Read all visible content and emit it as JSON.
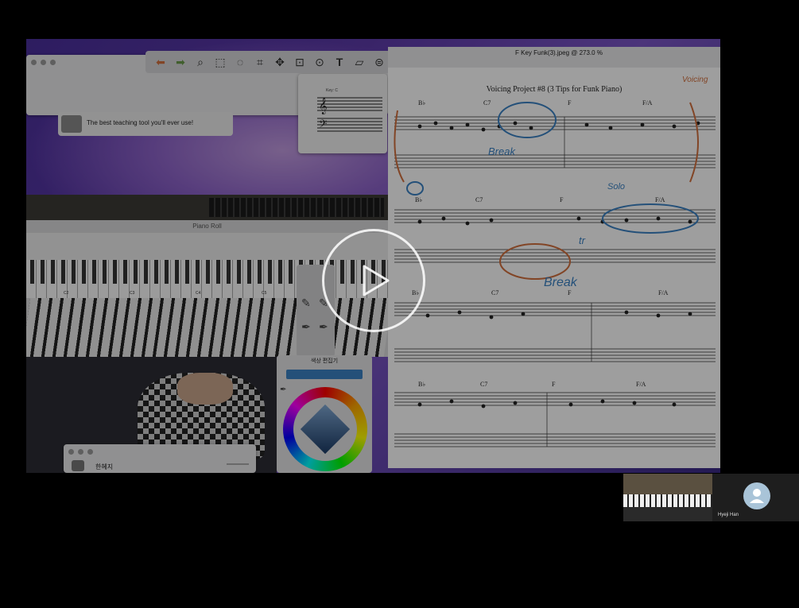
{
  "score": {
    "window_title": "F Key Funk(3).jpeg @ 273.0 %",
    "title": "Voicing Project #8 (3 Tips for Funk Piano)",
    "chords_row1": [
      "B♭",
      "C7",
      "F",
      "F/A"
    ],
    "chords_row2": [
      "B♭",
      "C7",
      "F",
      "F/A"
    ],
    "chords_row3": [
      "B♭",
      "C7",
      "F",
      "F/A"
    ],
    "chords_row4": [
      "B♭",
      "C7",
      "F",
      "F/A"
    ],
    "annotations": [
      "Break",
      "Solo",
      "tr",
      "Break",
      "Voicing"
    ]
  },
  "teacher_window": {
    "caption": "The best teaching tool you'll ever use!"
  },
  "key_window": {
    "label": "Key: C"
  },
  "piano_roll": {
    "title": "Piano Roll",
    "octave_labels": [
      "C2",
      "C3",
      "C4",
      "C5"
    ]
  },
  "color_editor": {
    "title": "색상 편집기"
  },
  "bottom_window": {
    "user": "한혜지"
  },
  "participant": {
    "name": "Hyeji Han"
  },
  "colors": {
    "annotation_blue": "#3b82c4",
    "annotation_orange": "#d2703e",
    "desktop_purple": "#5c3aa8"
  }
}
